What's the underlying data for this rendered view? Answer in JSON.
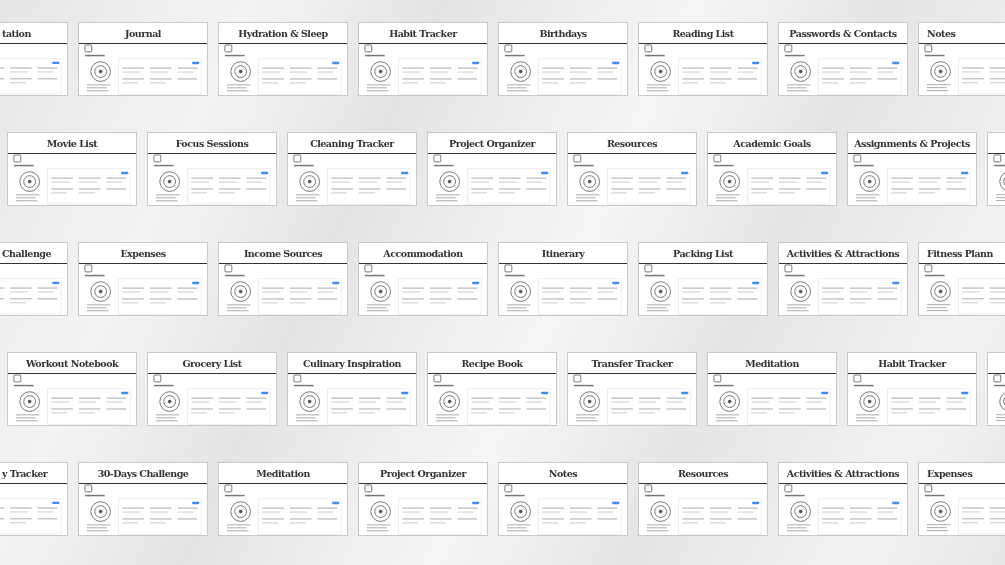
{
  "rows": [
    {
      "cards": [
        {
          "kind": "cut-left",
          "title": "tation"
        },
        {
          "kind": "full",
          "title": "Journal"
        },
        {
          "kind": "full",
          "title": "Hydration & Sleep"
        },
        {
          "kind": "full",
          "title": "Habit Tracker"
        },
        {
          "kind": "full",
          "title": "Birthdays"
        },
        {
          "kind": "full",
          "title": "Reading List"
        },
        {
          "kind": "full",
          "title": "Passwords & Contacts"
        },
        {
          "kind": "cut-right",
          "title": "Notes"
        }
      ]
    },
    {
      "cards": [
        {
          "kind": "full",
          "title": "Movie List"
        },
        {
          "kind": "full",
          "title": "Focus Sessions"
        },
        {
          "kind": "full",
          "title": "Cleaning Tracker"
        },
        {
          "kind": "full",
          "title": "Project Organizer"
        },
        {
          "kind": "full",
          "title": "Resources"
        },
        {
          "kind": "full",
          "title": "Academic Goals"
        },
        {
          "kind": "full",
          "title": "Assignments & Projects"
        },
        {
          "kind": "cut-right"
        }
      ]
    },
    {
      "cards": [
        {
          "kind": "cut-left",
          "title": "Challenge"
        },
        {
          "kind": "full",
          "title": "Expenses"
        },
        {
          "kind": "full",
          "title": "Income Sources"
        },
        {
          "kind": "full",
          "title": "Accommodation"
        },
        {
          "kind": "full",
          "title": "Itinerary"
        },
        {
          "kind": "full",
          "title": "Packing List"
        },
        {
          "kind": "full",
          "title": "Activities & Attractions"
        },
        {
          "kind": "cut-right",
          "title": "Fitness Plann"
        }
      ]
    },
    {
      "cards": [
        {
          "kind": "full",
          "title": "Workout Notebook"
        },
        {
          "kind": "full",
          "title": "Grocery List"
        },
        {
          "kind": "full",
          "title": "Culinary Inspiration"
        },
        {
          "kind": "full",
          "title": "Recipe Book"
        },
        {
          "kind": "full",
          "title": "Transfer Tracker"
        },
        {
          "kind": "full",
          "title": "Meditation"
        },
        {
          "kind": "full",
          "title": "Habit Tracker"
        },
        {
          "kind": "cut-right"
        }
      ]
    },
    {
      "cards": [
        {
          "kind": "cut-left",
          "title": "y Tracker"
        },
        {
          "kind": "full",
          "title": "30-Days Challenge"
        },
        {
          "kind": "full",
          "title": "Meditation"
        },
        {
          "kind": "full",
          "title": "Project Organizer"
        },
        {
          "kind": "full",
          "title": "Notes"
        },
        {
          "kind": "full",
          "title": "Resources"
        },
        {
          "kind": "full",
          "title": "Activities & Attractions"
        },
        {
          "kind": "cut-right",
          "title": "Expenses"
        }
      ]
    }
  ]
}
